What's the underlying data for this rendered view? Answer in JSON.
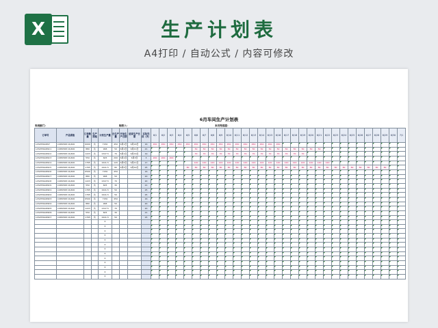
{
  "banner": {
    "logo_letter": "X",
    "title": "生产计划表",
    "subtitle": "A4打印 / 自动公式 / 内容可修改"
  },
  "sheet": {
    "title": "6月车间生产计划表",
    "meta": {
      "workshop_label": "车间部门：",
      "owner_label": "制表人：",
      "progress_label": "本月完成度："
    },
    "columns": {
      "order_no": "订单号",
      "spec": "产品规格",
      "order_qty": "订单数量",
      "unit": "生产规格",
      "plan_qty": "计划生产量",
      "daily_qty": "日生产量",
      "start_date": "开始生产日期",
      "end_date": "结束生产日期",
      "done_qty": "实际完成（天）"
    },
    "dates": [
      "6/1",
      "6/2",
      "6/3",
      "6/4",
      "6/5",
      "6/6",
      "6/7",
      "6/8",
      "6/9",
      "6/10",
      "6/11",
      "6/12",
      "6/13",
      "6/14",
      "6/15",
      "6/16",
      "6/17",
      "6/18",
      "6/19",
      "6/20",
      "6/21",
      "6/22",
      "6/23",
      "6/24",
      "6/25",
      "6/26",
      "6/27",
      "6/28",
      "6/29",
      "6/30",
      "7/1"
    ],
    "rows": [
      {
        "order_no": "LXS2556A897",
        "spec": "LSM4568 16/400",
        "order_qty": "6000",
        "unit": "片",
        "plan_qty": "7150",
        "daily_qty": "450",
        "start_date": "6月1日",
        "end_date": "6月16日",
        "done_qty": "16",
        "plan_start": 0,
        "plan_len": 16,
        "cell_value": "450"
      },
      {
        "order_no": "LXS2556A89C1",
        "spec": "LSM4568 16/400",
        "order_qty": "880",
        "unit": "片",
        "plan_qty": "968",
        "daily_qty": "50",
        "start_date": "6月1日",
        "end_date": "6月21日",
        "done_qty": "21",
        "plan_start": 5,
        "plan_len": 16,
        "cell_value": "50"
      },
      {
        "order_no": "LXS2556A89C2",
        "spec": "LSM4568 16/400",
        "order_qty": "1223",
        "unit": "片",
        "plan_qty": "1347.5",
        "daily_qty": "70",
        "start_date": "6月1日",
        "end_date": "6月19日",
        "done_qty": "19",
        "plan_start": 5,
        "plan_len": 14,
        "cell_value": "70"
      },
      {
        "order_no": "LXS2556A89C3",
        "spec": "LSM4568 16/400",
        "order_qty": "550",
        "unit": "片",
        "plan_qty": "605",
        "daily_qty": "200",
        "start_date": "6月1日",
        "end_date": "6月3日",
        "done_qty": "3",
        "plan_start": 0,
        "plan_len": 3,
        "cell_value": "200"
      },
      {
        "order_no": "LXS2556A89C4",
        "spec": "LSM4568 16/400",
        "order_qty": "1765",
        "unit": "片",
        "plan_qty": "1941.5",
        "daily_qty": "120",
        "start_date": "6月5日",
        "end_date": "6月21日",
        "done_qty": "17",
        "plan_start": 5,
        "plan_len": 17,
        "cell_value": "120"
      },
      {
        "order_no": "LXS2556A89C5",
        "spec": "LSM4568 16/400",
        "order_qty": "1765",
        "unit": "片",
        "plan_qty": "1941.5",
        "daily_qty": "80",
        "start_date": "6月5日",
        "end_date": "6月29日",
        "done_qty": "25",
        "plan_start": 4,
        "plan_len": 25,
        "cell_value": "80"
      },
      {
        "order_no": "LXS2556A89C6",
        "spec": "LSM4568 16/400",
        "order_qty": "6500",
        "unit": "片",
        "plan_qty": "7150",
        "daily_qty": "450",
        "start_date": "",
        "end_date": "",
        "done_qty": "16",
        "plan_start": -1,
        "plan_len": 0,
        "cell_value": ""
      },
      {
        "order_no": "LXS2556A89C7",
        "spec": "LSM4568 16/400",
        "order_qty": "880",
        "unit": "片",
        "plan_qty": "968",
        "daily_qty": "50",
        "start_date": "",
        "end_date": "",
        "done_qty": "20",
        "plan_start": -1,
        "plan_len": 0,
        "cell_value": ""
      },
      {
        "order_no": "LXS2556A89C8",
        "spec": "LSM4568 16/400",
        "order_qty": "1223",
        "unit": "片",
        "plan_qty": "1347.5",
        "daily_qty": "70",
        "start_date": "",
        "end_date": "",
        "done_qty": "20",
        "plan_start": -1,
        "plan_len": 0,
        "cell_value": ""
      },
      {
        "order_no": "LXS2556A89C9",
        "spec": "LSM4568 16/400",
        "order_qty": "550",
        "unit": "片",
        "plan_qty": "605",
        "daily_qty": "30",
        "start_date": "",
        "end_date": "",
        "done_qty": "21",
        "plan_start": -1,
        "plan_len": 0,
        "cell_value": ""
      },
      {
        "order_no": "LXS2556A89D1",
        "spec": "LSM4568 16/400",
        "order_qty": "1765",
        "unit": "片",
        "plan_qty": "1941.5",
        "daily_qty": "50",
        "start_date": "",
        "end_date": "",
        "done_qty": "25",
        "plan_start": -1,
        "plan_len": 0,
        "cell_value": ""
      },
      {
        "order_no": "LXS2556A89D2",
        "spec": "LSM4568 16/400",
        "order_qty": "1765",
        "unit": "片",
        "plan_qty": "1941.5",
        "daily_qty": "50",
        "start_date": "",
        "end_date": "",
        "done_qty": "25",
        "plan_start": -1,
        "plan_len": 0,
        "cell_value": ""
      },
      {
        "order_no": "LXS2556A89D3",
        "spec": "LSM4568 16/400",
        "order_qty": "6500",
        "unit": "片",
        "plan_qty": "7150",
        "daily_qty": "450",
        "start_date": "",
        "end_date": "",
        "done_qty": "16",
        "plan_start": -1,
        "plan_len": 0,
        "cell_value": ""
      },
      {
        "order_no": "LXS2556A89D4",
        "spec": "LSM4568 16/400",
        "order_qty": "880",
        "unit": "片",
        "plan_qty": "968",
        "daily_qty": "50",
        "start_date": "",
        "end_date": "",
        "done_qty": "20",
        "plan_start": -1,
        "plan_len": 0,
        "cell_value": ""
      },
      {
        "order_no": "LXS2556A89D5",
        "spec": "LSM4568 16/400",
        "order_qty": "1223",
        "unit": "片",
        "plan_qty": "1347.5",
        "daily_qty": "70",
        "start_date": "",
        "end_date": "",
        "done_qty": "20",
        "plan_start": -1,
        "plan_len": 0,
        "cell_value": ""
      },
      {
        "order_no": "LXS2556A89D6",
        "spec": "LSM4568 16/400",
        "order_qty": "550",
        "unit": "片",
        "plan_qty": "605",
        "daily_qty": "30",
        "start_date": "",
        "end_date": "",
        "done_qty": "21",
        "plan_start": -1,
        "plan_len": 0,
        "cell_value": ""
      },
      {
        "order_no": "LXS2556A89D7",
        "spec": "LSM4568 16/400",
        "order_qty": "1765",
        "unit": "片",
        "plan_qty": "1941.5",
        "daily_qty": "50",
        "start_date": "",
        "end_date": "",
        "done_qty": "25",
        "plan_start": -1,
        "plan_len": 0,
        "cell_value": ""
      }
    ],
    "empty_row_count": 13,
    "empty_row_plan_value": "0"
  }
}
